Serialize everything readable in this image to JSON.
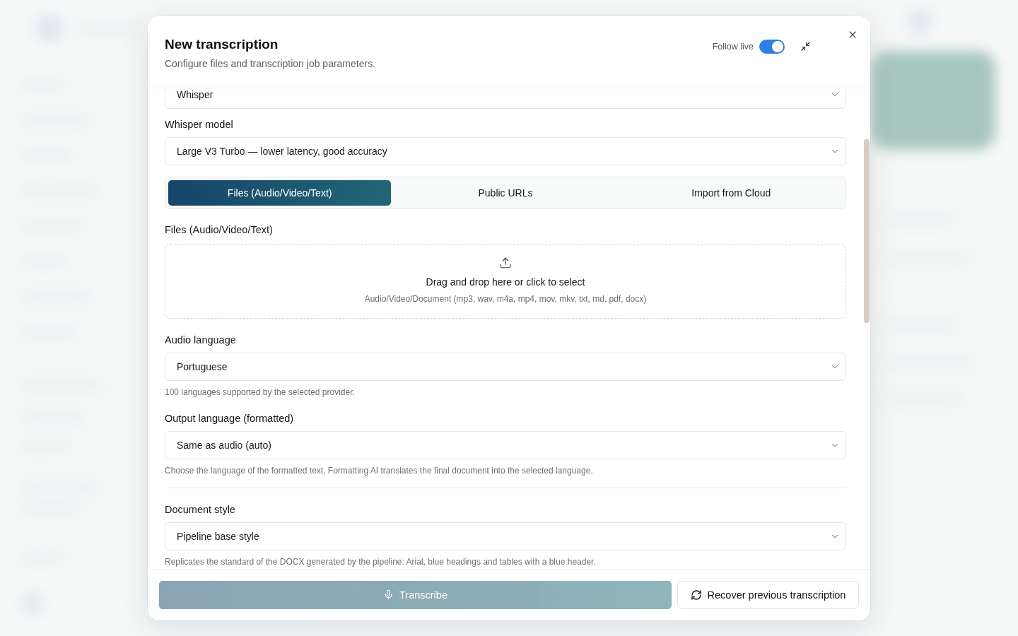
{
  "dialog": {
    "title": "New transcription",
    "subtitle": "Configure files and transcription job parameters.",
    "follow_live": {
      "label": "Follow live",
      "on": true
    }
  },
  "provider_select": {
    "value": "Whisper"
  },
  "whisper_model": {
    "label": "Whisper model",
    "value": "Large V3 Turbo — lower latency, good accuracy"
  },
  "source_tabs": [
    {
      "label": "Files (Audio/Video/Text)",
      "selected": true
    },
    {
      "label": "Public URLs",
      "selected": false
    },
    {
      "label": "Import from Cloud",
      "selected": false
    }
  ],
  "files": {
    "label": "Files (Audio/Video/Text)",
    "dropzone": {
      "title": "Drag and drop here or click to select",
      "formats": "Audio/Video/Document (mp3, wav, m4a, mp4, mov, mkv, txt, md, pdf, docx)"
    }
  },
  "language_fields": [
    {
      "label": "Audio language",
      "value": "Portuguese",
      "hint": "100 languages supported by the selected provider."
    },
    {
      "label": "Output language (formatted)",
      "value": "Same as audio (auto)",
      "hint": "Choose the language of the formatted text. Formatting AI translates the final document into the selected language."
    }
  ],
  "document_style": {
    "label": "Document style",
    "value": "Pipeline base style",
    "hint": "Replicates the standard of the DOCX generated by the pipeline: Arial, blue headings and tables with a blue header."
  },
  "footer": {
    "transcribe": {
      "label": "Transcribe",
      "disabled": true
    },
    "recover": {
      "label": "Recover previous transcription"
    }
  }
}
